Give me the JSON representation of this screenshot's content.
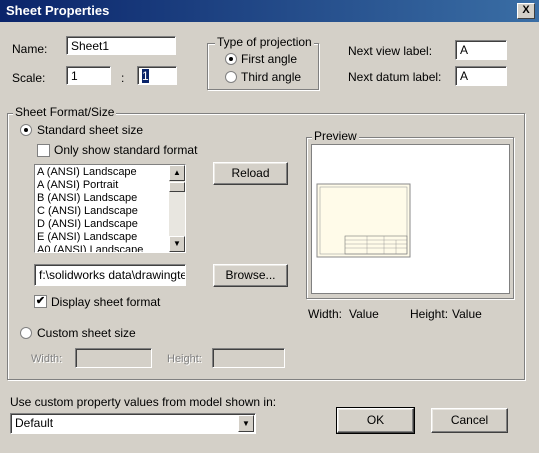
{
  "title": "Sheet Properties",
  "close_glyph": "X",
  "name_label": "Name:",
  "name_value": "Sheet1",
  "scale_label": "Scale:",
  "scale_num": "1",
  "scale_sep": ":",
  "scale_den": "1",
  "projection": {
    "group_label": "Type of projection",
    "first": "First angle",
    "third": "Third angle",
    "selected": "first"
  },
  "next_view_label": "Next view label:",
  "next_view_value": "A",
  "next_datum_label": "Next datum label:",
  "next_datum_value": "A",
  "format_group_label": "Sheet Format/Size",
  "standard_size_label": "Standard sheet size",
  "only_standard_label": "Only show standard format",
  "sizes": [
    "A (ANSI) Landscape",
    "A (ANSI) Portrait",
    "B (ANSI) Landscape",
    "C (ANSI) Landscape",
    "D (ANSI) Landscape",
    "E (ANSI) Landscape",
    "A0 (ANSI) Landscape"
  ],
  "reload_label": "Reload",
  "format_path": "f:\\solidworks data\\drawingter",
  "browse_label": "Browse...",
  "display_format_label": "Display sheet format",
  "display_format_checked": true,
  "custom_size_label": "Custom sheet size",
  "width_label": "Width:",
  "height_label": "Height:",
  "preview": {
    "group_label": "Preview",
    "width_label": "Width:",
    "width_value": "Value",
    "height_label": "Height:",
    "height_value": "Value"
  },
  "custom_property_label": "Use custom property values from model shown in:",
  "model_select_value": "Default",
  "ok_label": "OK",
  "cancel_label": "Cancel"
}
